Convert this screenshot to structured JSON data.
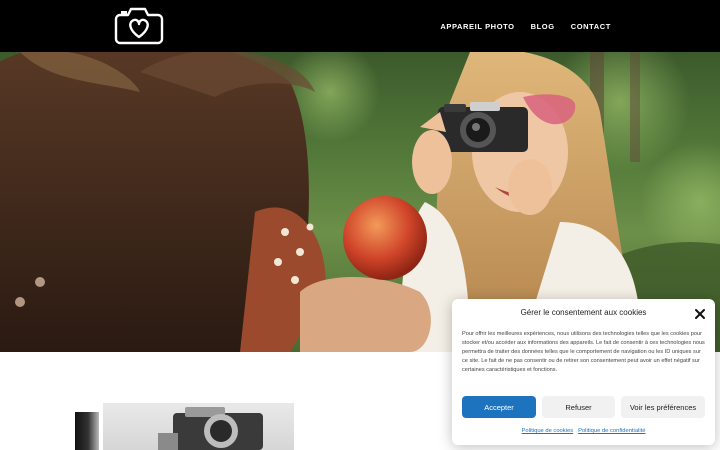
{
  "header": {
    "nav": [
      {
        "label": "APPAREIL PHOTO"
      },
      {
        "label": "BLOG"
      },
      {
        "label": "CONTACT"
      }
    ]
  },
  "cookie_banner": {
    "title": "Gérer le consentement aux cookies",
    "body": "Pour offrir les meilleures expériences, nous utilisons des technologies telles que les cookies pour stocker et/ou accéder aux informations des appareils. Le fait de consentir à ces technologies nous permettra de traiter des données telles que le comportement de navigation ou les ID uniques sur ce site. Le fait de ne pas consentir ou de retirer son consentement peut avoir un effet négatif sur certaines caractéristiques et fonctions.",
    "buttons": {
      "accept": "Accepter",
      "refuse": "Refuser",
      "preferences": "Voir les préférences"
    },
    "links": {
      "cookie_policy": "Politique de cookies",
      "privacy_policy": "Politique de confidentialité"
    },
    "accent_color": "#1e73be"
  },
  "icons": {
    "logo": "camera-heart-icon",
    "close": "close-icon"
  }
}
